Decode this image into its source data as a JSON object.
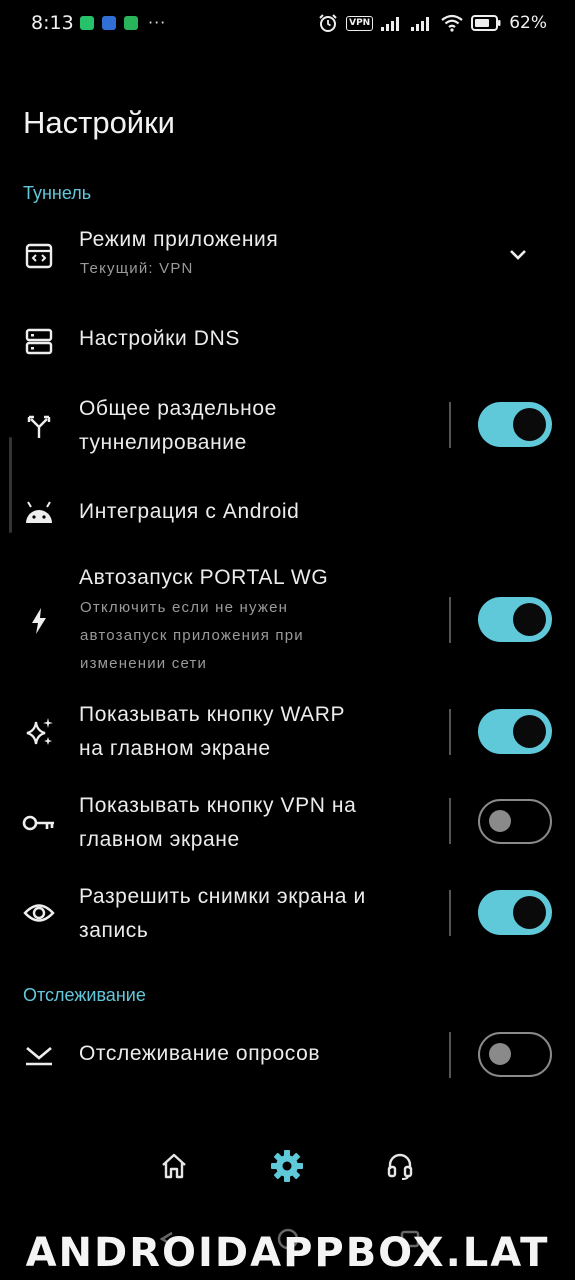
{
  "status_bar": {
    "time": "8:13",
    "vpn_label": "VPN",
    "battery_percent": "62%"
  },
  "page_title": "Настройки",
  "sections": {
    "tunnel": "Туннель",
    "tracking": "Отслеживание"
  },
  "settings": {
    "app_mode": {
      "title": "Режим приложения",
      "subtitle": "Текущий: VPN",
      "icon": "app-code-icon"
    },
    "dns": {
      "title": "Настройки DNS",
      "icon": "dns-server-icon"
    },
    "split_tunnel": {
      "title": "Общее раздельное\nтуннелирование",
      "enabled": true,
      "icon": "split-arrow-icon"
    },
    "android_integration": {
      "title": "Интеграция с Android",
      "icon": "android-icon"
    },
    "autostart": {
      "title": "Автозапуск PORTAL WG",
      "subtitle": "Отключить если не нужен\nавтозапуск приложения при\nизменении сети",
      "enabled": true,
      "icon": "bolt-icon"
    },
    "warp_button": {
      "title": "Показывать кнопку WARP\nна главном экране",
      "enabled": true,
      "icon": "sparkles-icon"
    },
    "vpn_button": {
      "title": "Показывать кнопку VPN на\nглавном экране",
      "enabled": false,
      "icon": "key-icon"
    },
    "screenshots": {
      "title": "Разрешить снимки экрана и\nзапись",
      "enabled": true,
      "icon": "eye-icon"
    },
    "poll_tracking": {
      "title": "Отслеживание опросов",
      "enabled": false,
      "icon": "poll-icon"
    }
  },
  "bottom_nav": {
    "items": [
      {
        "icon": "home-icon",
        "active": false
      },
      {
        "icon": "gear-icon",
        "active": true
      },
      {
        "icon": "headset-icon",
        "active": false
      }
    ]
  },
  "watermark": "ANDROIDAPPBOX.LAT",
  "colors": {
    "accent": "#5fc8d9",
    "section_header": "#63c7db",
    "background": "#000000"
  }
}
